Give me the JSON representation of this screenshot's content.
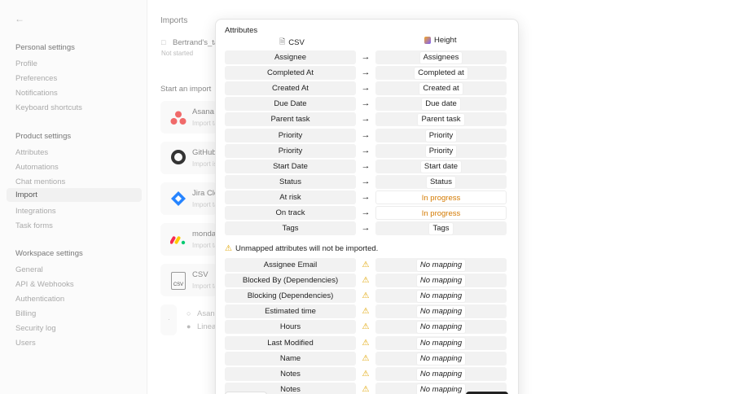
{
  "sidebar": {
    "personal_title": "Personal settings",
    "personal_items": [
      "Profile",
      "Preferences",
      "Notifications",
      "Keyboard shortcuts"
    ],
    "product_title": "Product settings",
    "product_items": [
      "Attributes",
      "Automations",
      "Chat mentions",
      "Import",
      "Integrations",
      "Task forms"
    ],
    "workspace_title": "Workspace settings",
    "workspace_items": [
      "General",
      "API & Webhooks",
      "Authentication",
      "Billing",
      "Security log",
      "Users"
    ]
  },
  "background": {
    "imports_title": "Imports",
    "file_name": "Bertrand's_ta",
    "file_status": "Not started",
    "start_title": "Start an import",
    "cards": [
      {
        "name": "Asana",
        "sub": "Import ta"
      },
      {
        "name": "GitHub",
        "sub": "Import is"
      },
      {
        "name": "Jira Clo",
        "sub": "Import ta"
      },
      {
        "name": "monda",
        "sub": "Import ta"
      },
      {
        "name": "CSV",
        "sub": "Import ta"
      }
    ],
    "more": [
      "Asan",
      "Linea"
    ],
    "csv_logo_text": "CSV"
  },
  "modal": {
    "title": "Attributes",
    "left_header": "CSV",
    "right_header": "Height",
    "mapped": [
      {
        "source": "Assignee",
        "target": "Assignees",
        "style": "chip"
      },
      {
        "source": "Completed At",
        "target": "Completed at",
        "style": "chip"
      },
      {
        "source": "Created At",
        "target": "Created at",
        "style": "chip"
      },
      {
        "source": "Due Date",
        "target": "Due date",
        "style": "chip"
      },
      {
        "source": "Parent task",
        "target": "Parent task",
        "style": "chip"
      },
      {
        "source": "Priority",
        "target": "Priority",
        "style": "chip"
      },
      {
        "source": "Priority",
        "target": "Priority",
        "style": "chip"
      },
      {
        "source": "Start Date",
        "target": "Start date",
        "style": "chip"
      },
      {
        "source": "Status",
        "target": "Status",
        "style": "chip"
      },
      {
        "source": "At risk",
        "target": "In progress",
        "style": "orange"
      },
      {
        "source": "On track",
        "target": "In progress",
        "style": "orange"
      },
      {
        "source": "Tags",
        "target": "Tags",
        "style": "chip"
      }
    ],
    "unmapped_note": "Unmapped attributes will not be imported.",
    "no_mapping_label": "No mapping",
    "unmapped": [
      "Assignee Email",
      "Blocked By (Dependencies)",
      "Blocking (Dependencies)",
      "Estimated time",
      "Hours",
      "Last Modified",
      "Name",
      "Notes",
      "Notes"
    ]
  },
  "colors": {
    "accent_orange": "#d47a00",
    "warning": "#e0a400"
  }
}
